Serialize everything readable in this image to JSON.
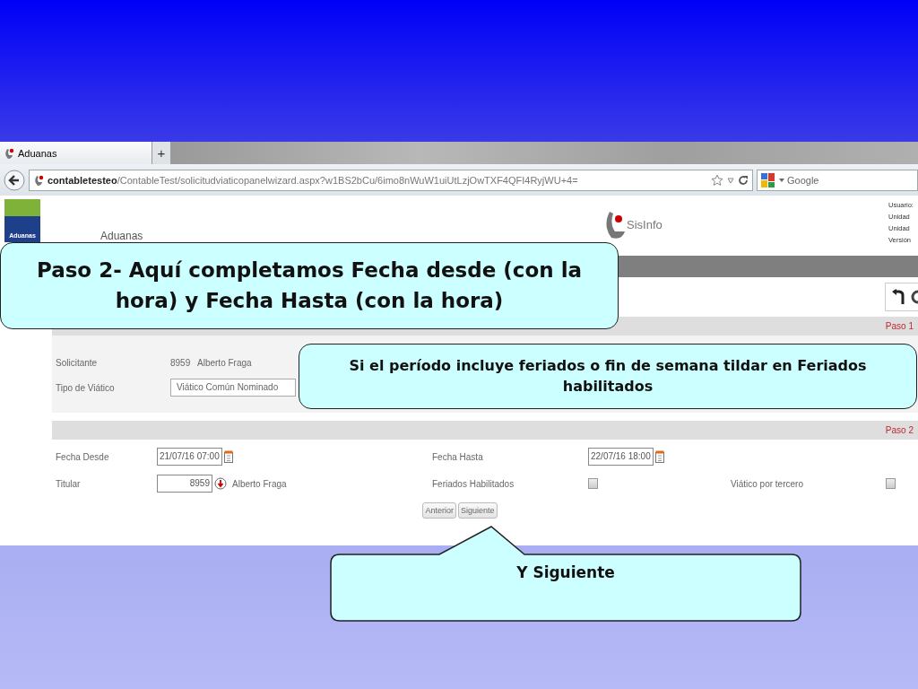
{
  "browser": {
    "tab_title": "Aduanas",
    "new_tab_label": "+",
    "url_host": "contabletesteo",
    "url_path": "/ContableTest/solicitudviaticopanelwizard.aspx?w1BS2bCu/6imo8nWuW1uiUtLzjOwTXF4QFI4RyjWU+4=",
    "search_engine": "Google"
  },
  "header": {
    "logo_text": "Aduanas",
    "app_title": "Aduanas",
    "brand": "SisInfo",
    "user_info": [
      "Usuario:",
      "Unidad",
      "Unidad",
      "Versión"
    ]
  },
  "step1": {
    "label": "Paso 1",
    "solicitante": {
      "label": "Solicitante",
      "code": "8959",
      "name": "Alberto Fraga"
    },
    "tipo_viatico": {
      "label": "Tipo de Viático",
      "value": "Viático Común Nominado"
    }
  },
  "step2": {
    "label": "Paso 2",
    "fecha_desde": {
      "label": "Fecha Desde",
      "value": "21/07/16 07:00"
    },
    "fecha_hasta": {
      "label": "Fecha Hasta",
      "value": "22/07/16 18:00"
    },
    "titular": {
      "label": "Titular",
      "value": "8959",
      "name": "Alberto Fraga"
    },
    "feriados_habilitados": {
      "label": "Feriados Habilitados",
      "checked": false
    },
    "viatico_por_tercero": {
      "label": "Viático por tercero",
      "checked": false
    }
  },
  "buttons": [
    {
      "label": "Anterior"
    },
    {
      "label": "Siguiente"
    }
  ],
  "callouts": [
    {
      "kind": "box",
      "text": "Paso 2- Aquí completamos Fecha desde (con la hora) y Fecha Hasta (con la hora)"
    },
    {
      "kind": "box",
      "text": "Si el período incluye feriados o fin de semana tildar en Feriados habilitados"
    },
    {
      "kind": "tail",
      "text": "Y Siguiente"
    }
  ]
}
